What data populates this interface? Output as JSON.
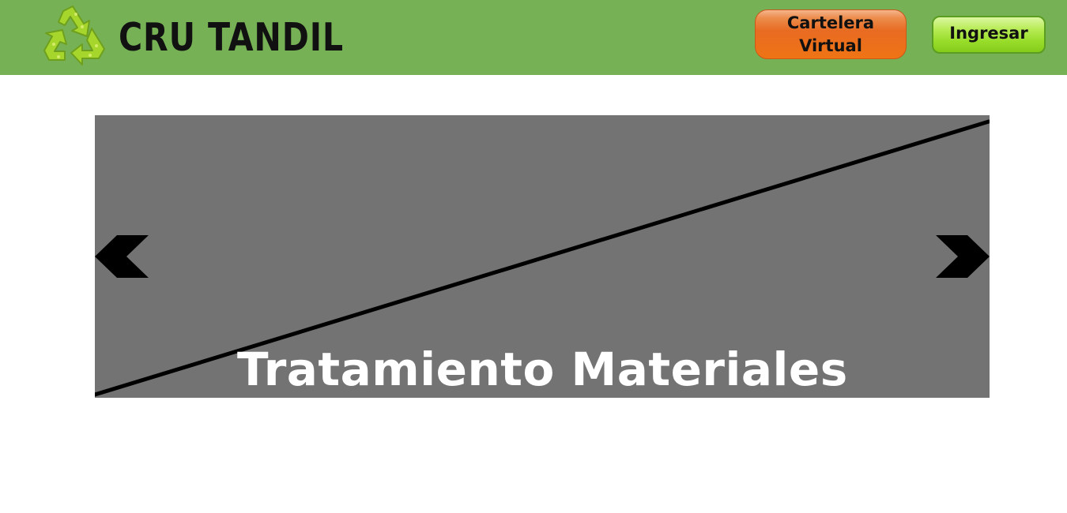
{
  "header": {
    "logo_icon": "recycle-icon",
    "brand": "CRU TANDIL",
    "cartelera_button": "Cartelera\nVirtual",
    "login_button": "Ingresar"
  },
  "carousel": {
    "caption": "Tratamiento Materiales",
    "prev_icon": "chevron-left-icon",
    "next_icon": "chevron-right-icon",
    "image_state": "broken-image-placeholder"
  },
  "colors": {
    "header_bg": "#76b255",
    "carousel_bg": "#737373",
    "cartelera_orange": "#ef7414",
    "login_green": "#97dc29"
  }
}
